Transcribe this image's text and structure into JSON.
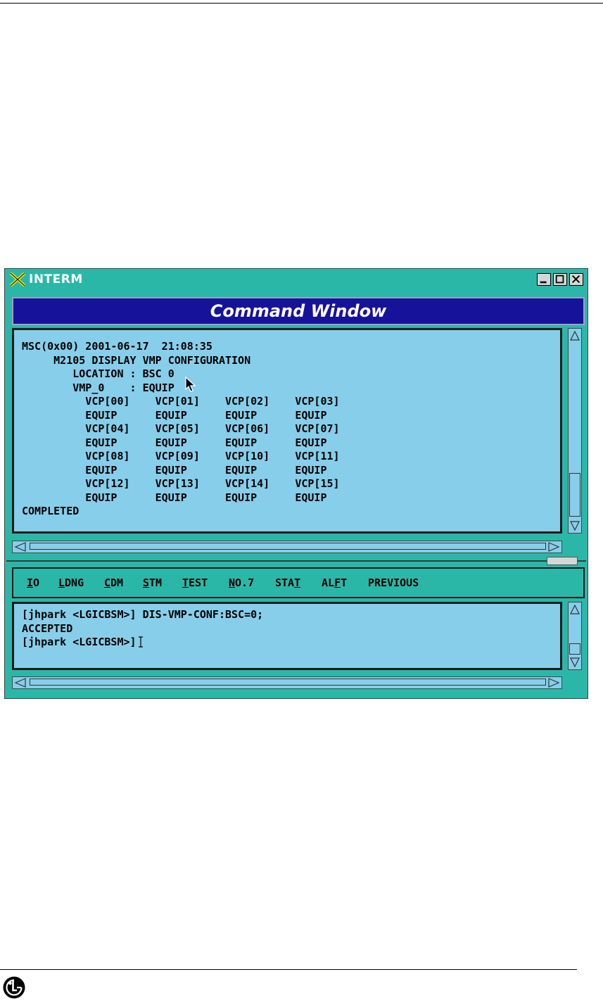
{
  "window": {
    "title": "INTERM",
    "banner": "Command Window"
  },
  "output": {
    "lines": [
      "MSC(0x00) 2001-06-17  21:08:35",
      "     M2105 DISPLAY VMP CONFIGURATION",
      "        LOCATION : BSC 0",
      "        VMP_0    : EQUIP",
      "          VCP[00]    VCP[01]    VCP[02]    VCP[03]",
      "          EQUIP      EQUIP      EQUIP      EQUIP",
      "          VCP[04]    VCP[05]    VCP[06]    VCP[07]",
      "          EQUIP      EQUIP      EQUIP      EQUIP",
      "          VCP[08]    VCP[09]    VCP[10]    VCP[11]",
      "          EQUIP      EQUIP      EQUIP      EQUIP",
      "          VCP[12]    VCP[13]    VCP[14]    VCP[15]",
      "          EQUIP      EQUIP      EQUIP      EQUIP",
      "COMPLETED"
    ]
  },
  "menu": {
    "items": [
      {
        "pre": "",
        "mn": "I",
        "post": "O"
      },
      {
        "pre": "",
        "mn": "L",
        "post": "DNG"
      },
      {
        "pre": "",
        "mn": "C",
        "post": "DM"
      },
      {
        "pre": "",
        "mn": "S",
        "post": "TM"
      },
      {
        "pre": "",
        "mn": "T",
        "post": "EST"
      },
      {
        "pre": "",
        "mn": "N",
        "post": "O.7"
      },
      {
        "pre": "STA",
        "mn": "T",
        "post": ""
      },
      {
        "pre": "AL",
        "mn": "F",
        "post": "T"
      },
      {
        "pre": "PREVIOUS",
        "mn": "",
        "post": ""
      }
    ]
  },
  "input": {
    "lines": [
      "[jhpark <LGICBSM>] DIS-VMP-CONF:BSC=0;",
      "ACCEPTED",
      "[jhpark <LGICBSM>]"
    ]
  },
  "icons": {
    "app": "x-window-icon",
    "logo": "lg-logo",
    "minimize": "minimize-icon",
    "maximize": "maximize-icon",
    "close": "close-icon"
  },
  "colors": {
    "window_frame": "#2bb7a8",
    "banner": "#16139a",
    "pane": "#87ceea"
  }
}
